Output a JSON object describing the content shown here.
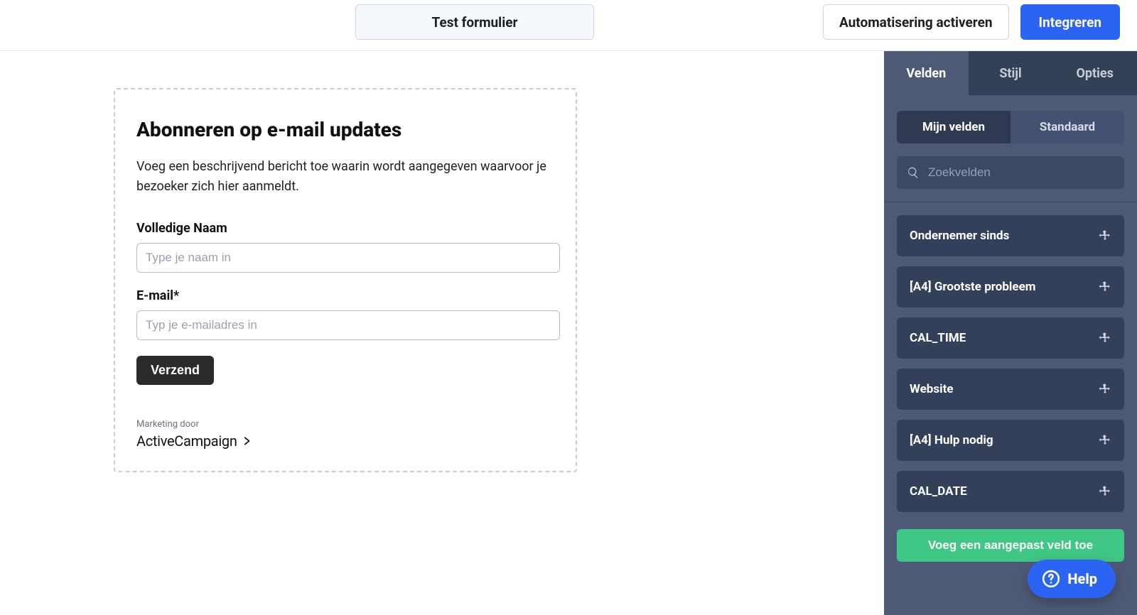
{
  "topbar": {
    "test_form_label": "Test formulier",
    "activate_automation_label": "Automatisering activeren",
    "integrate_label": "Integreren"
  },
  "form": {
    "title": "Abonneren op e-mail updates",
    "description": "Voeg een beschrijvend bericht toe waarin wordt aangegeven waarvoor je bezoeker zich hier aanmeldt.",
    "fields": {
      "fullname": {
        "label": "Volledige Naam",
        "placeholder": "Type je naam in"
      },
      "email": {
        "label": "E-mail*",
        "placeholder": "Typ je e-mailadres in"
      }
    },
    "submit_label": "Verzend",
    "marketing_by": "Marketing door",
    "brand": "ActiveCampaign"
  },
  "sidebar": {
    "tabs": {
      "fields": "Velden",
      "style": "Stijl",
      "options": "Opties",
      "active": "fields"
    },
    "segment": {
      "mine": "Mijn velden",
      "standard": "Standaard",
      "active": "mine"
    },
    "search_placeholder": "Zoekvelden",
    "items": [
      {
        "label": "Ondernemer sinds"
      },
      {
        "label": "[A4] Grootste probleem"
      },
      {
        "label": "CAL_TIME"
      },
      {
        "label": "Website"
      },
      {
        "label": "[A4] Hulp nodig"
      },
      {
        "label": "CAL_DATE"
      }
    ],
    "add_field_label": "Voeg een aangepast veld toe",
    "help_label": "Help"
  }
}
